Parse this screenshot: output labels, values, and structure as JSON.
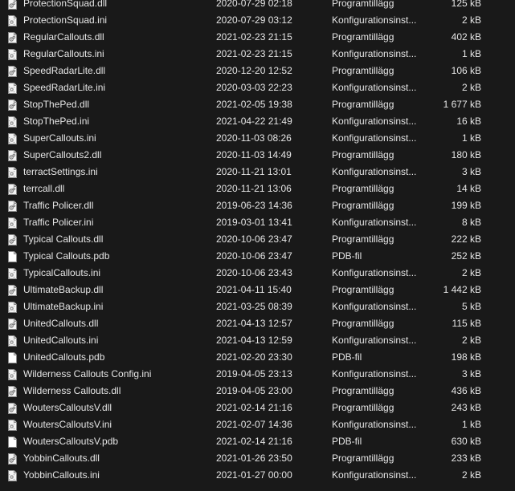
{
  "files": [
    {
      "name": "ProtectionSquad.dll",
      "date": "2020-07-29 02:18",
      "type": "Programtillägg",
      "size": "125 kB",
      "icon": "dll-file-icon"
    },
    {
      "name": "ProtectionSquad.ini",
      "date": "2020-07-29 03:12",
      "type": "Konfigurationsinst...",
      "size": "2 kB",
      "icon": "ini-file-icon"
    },
    {
      "name": "RegularCallouts.dll",
      "date": "2021-02-23 21:15",
      "type": "Programtillägg",
      "size": "402 kB",
      "icon": "dll-file-icon"
    },
    {
      "name": "RegularCallouts.ini",
      "date": "2021-02-23 21:15",
      "type": "Konfigurationsinst...",
      "size": "1 kB",
      "icon": "ini-file-icon"
    },
    {
      "name": "SpeedRadarLite.dll",
      "date": "2020-12-20 12:52",
      "type": "Programtillägg",
      "size": "106 kB",
      "icon": "dll-file-icon"
    },
    {
      "name": "SpeedRadarLite.ini",
      "date": "2020-03-03 22:23",
      "type": "Konfigurationsinst...",
      "size": "2 kB",
      "icon": "ini-file-icon"
    },
    {
      "name": "StopThePed.dll",
      "date": "2021-02-05 19:38",
      "type": "Programtillägg",
      "size": "1 677 kB",
      "icon": "dll-file-icon"
    },
    {
      "name": "StopThePed.ini",
      "date": "2021-04-22 21:49",
      "type": "Konfigurationsinst...",
      "size": "16 kB",
      "icon": "ini-file-icon"
    },
    {
      "name": "SuperCallouts.ini",
      "date": "2020-11-03 08:26",
      "type": "Konfigurationsinst...",
      "size": "1 kB",
      "icon": "ini-file-icon"
    },
    {
      "name": "SuperCallouts2.dll",
      "date": "2020-11-03 14:49",
      "type": "Programtillägg",
      "size": "180 kB",
      "icon": "dll-file-icon"
    },
    {
      "name": "terractSettings.ini",
      "date": "2020-11-21 13:01",
      "type": "Konfigurationsinst...",
      "size": "3 kB",
      "icon": "ini-file-icon"
    },
    {
      "name": "terrcall.dll",
      "date": "2020-11-21 13:06",
      "type": "Programtillägg",
      "size": "14 kB",
      "icon": "dll-file-icon"
    },
    {
      "name": "Traffic Policer.dll",
      "date": "2019-06-23 14:36",
      "type": "Programtillägg",
      "size": "199 kB",
      "icon": "dll-file-icon"
    },
    {
      "name": "Traffic Policer.ini",
      "date": "2019-03-01 13:41",
      "type": "Konfigurationsinst...",
      "size": "8 kB",
      "icon": "ini-file-icon"
    },
    {
      "name": "Typical Callouts.dll",
      "date": "2020-10-06 23:47",
      "type": "Programtillägg",
      "size": "222 kB",
      "icon": "dll-file-icon"
    },
    {
      "name": "Typical Callouts.pdb",
      "date": "2020-10-06 23:47",
      "type": "PDB-fil",
      "size": "252 kB",
      "icon": "pdb-file-icon"
    },
    {
      "name": "TypicalCallouts.ini",
      "date": "2020-10-06 23:43",
      "type": "Konfigurationsinst...",
      "size": "2 kB",
      "icon": "ini-file-icon"
    },
    {
      "name": "UltimateBackup.dll",
      "date": "2021-04-11 15:40",
      "type": "Programtillägg",
      "size": "1 442 kB",
      "icon": "dll-file-icon"
    },
    {
      "name": "UltimateBackup.ini",
      "date": "2021-03-25 08:39",
      "type": "Konfigurationsinst...",
      "size": "5 kB",
      "icon": "ini-file-icon"
    },
    {
      "name": "UnitedCallouts.dll",
      "date": "2021-04-13 12:57",
      "type": "Programtillägg",
      "size": "115 kB",
      "icon": "dll-file-icon"
    },
    {
      "name": "UnitedCallouts.ini",
      "date": "2021-04-13 12:59",
      "type": "Konfigurationsinst...",
      "size": "2 kB",
      "icon": "ini-file-icon"
    },
    {
      "name": "UnitedCallouts.pdb",
      "date": "2021-02-20 23:30",
      "type": "PDB-fil",
      "size": "198 kB",
      "icon": "pdb-file-icon"
    },
    {
      "name": "Wilderness Callouts Config.ini",
      "date": "2019-04-05 23:13",
      "type": "Konfigurationsinst...",
      "size": "3 kB",
      "icon": "ini-file-icon"
    },
    {
      "name": "Wilderness Callouts.dll",
      "date": "2019-04-05 23:00",
      "type": "Programtillägg",
      "size": "436 kB",
      "icon": "dll-file-icon"
    },
    {
      "name": "WoutersCalloutsV.dll",
      "date": "2021-02-14 21:16",
      "type": "Programtillägg",
      "size": "243 kB",
      "icon": "dll-file-icon"
    },
    {
      "name": "WoutersCalloutsV.ini",
      "date": "2021-02-07 14:36",
      "type": "Konfigurationsinst...",
      "size": "1 kB",
      "icon": "ini-file-icon"
    },
    {
      "name": "WoutersCalloutsV.pdb",
      "date": "2021-02-14 21:16",
      "type": "PDB-fil",
      "size": "630 kB",
      "icon": "pdb-file-icon"
    },
    {
      "name": "YobbinCallouts.dll",
      "date": "2021-01-26 23:50",
      "type": "Programtillägg",
      "size": "233 kB",
      "icon": "dll-file-icon"
    },
    {
      "name": "YobbinCallouts.ini",
      "date": "2021-01-27 00:00",
      "type": "Konfigurationsinst...",
      "size": "2 kB",
      "icon": "ini-file-icon"
    }
  ],
  "colors": {
    "background": "#191919",
    "text": "#e6e6e6"
  }
}
